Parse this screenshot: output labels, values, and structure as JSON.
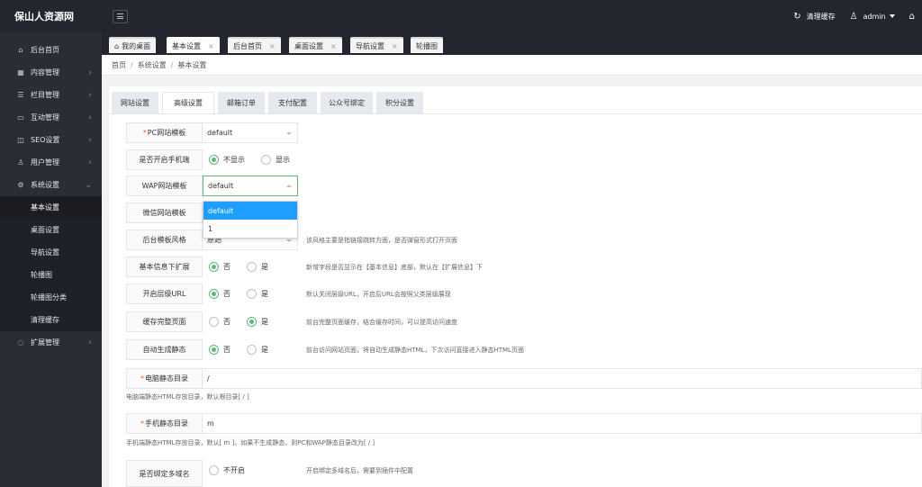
{
  "app": {
    "title": "保山人资源网"
  },
  "topbar": {
    "clear_cache": "清理缓存",
    "user": "admin"
  },
  "sidebar": {
    "items": [
      {
        "label": "后台首页",
        "icon": "home-icon"
      },
      {
        "label": "内容管理",
        "icon": "grid-icon"
      },
      {
        "label": "栏目管理",
        "icon": "list-icon"
      },
      {
        "label": "互动管理",
        "icon": "message-icon"
      },
      {
        "label": "SEO设置",
        "icon": "seo-icon"
      },
      {
        "label": "用户管理",
        "icon": "user-icon"
      },
      {
        "label": "系统设置",
        "icon": "gear-icon"
      }
    ],
    "sub_items": [
      "基本设置",
      "桌面设置",
      "导航设置",
      "轮播图",
      "轮播图分类",
      "清理缓存"
    ],
    "extra": {
      "label": "扩展管理",
      "icon": "extension-icon"
    }
  },
  "page_tabs": [
    "我的桌面",
    "基本设置",
    "后台首页",
    "桌面设置",
    "导航设置",
    "轮播图"
  ],
  "breadcrumb": [
    "首页",
    "系统设置",
    "基本设置"
  ],
  "setting_tabs": [
    "网站设置",
    "高级设置",
    "邮箱订单",
    "支付配置",
    "公众号绑定",
    "积分设置"
  ],
  "form": {
    "pc_template": {
      "label": "PC网站模板",
      "value": "default"
    },
    "mobile_enable": {
      "label": "是否开启手机端",
      "opt1": "不显示",
      "opt2": "显示"
    },
    "wap_template": {
      "label": "WAP网站模板",
      "value": "default"
    },
    "wechat_template": {
      "label": "微信网站模板"
    },
    "admin_style": {
      "label": "后台模板风格",
      "value": "原始",
      "hint": "该风格主要是指链接跳转方面，是否弹窗形式打开页面"
    },
    "basic_info": {
      "label": "基本信息下扩展",
      "opt1": "否",
      "opt2": "是",
      "hint": "新增字段是否显示在【基本信息】底部，默认在【扩展信息】下"
    },
    "level_url": {
      "label": "开启层级URL",
      "opt1": "否",
      "opt2": "是",
      "hint": "默认关闭层级URL，开启后URL会按照父类层级展现"
    },
    "cache_page": {
      "label": "缓存完整页面",
      "opt1": "否",
      "opt2": "是",
      "hint": "前台完整页面缓存，结合缓存时间，可以提高访问速度"
    },
    "auto_static": {
      "label": "自动生成静态",
      "opt1": "否",
      "opt2": "是",
      "hint": "前台访问网站页面，将自动生成静态HTML，下次访问直接进入静态HTML页面"
    },
    "pc_static_dir": {
      "label": "电脑静态目录",
      "value": "/",
      "hint": "电脑端静态HTML存放目录，默认根目录[ / ]"
    },
    "mobile_static_dir": {
      "label": "手机静态目录",
      "value": "m",
      "hint": "手机端静态HTML存放目录，默认[ m ]，如果不生成静态，则PC和WAP静态目录改为[ / ]"
    },
    "multi_domain": {
      "label": "是否绑定多域名",
      "opt1": "不开启",
      "hint": "开启绑定多域名后，需要到插件中配置"
    }
  },
  "dropdown_options": [
    "default",
    "1"
  ],
  "colors": {
    "accent_green": "#5fb878",
    "select_blue": "#1e9fff",
    "sidebar_bg": "#2a2d36"
  }
}
